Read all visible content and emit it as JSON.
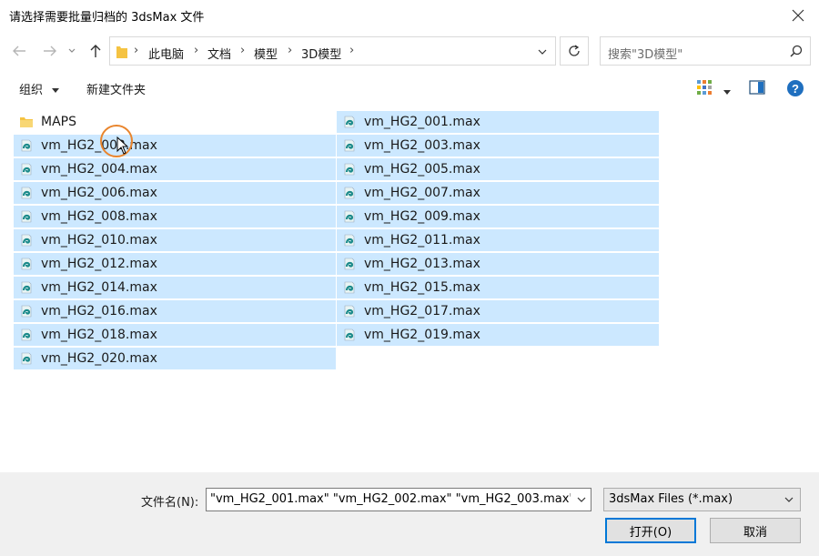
{
  "window": {
    "title": "请选择需要批量归档的 3dsMax 文件"
  },
  "address": {
    "crumbs": [
      "此电脑",
      "文档",
      "模型",
      "3D模型"
    ]
  },
  "search": {
    "placeholder": "搜索\"3D模型\""
  },
  "toolbar": {
    "organize": "组织",
    "new_folder": "新建文件夹"
  },
  "files": {
    "left": [
      {
        "name": "MAPS",
        "type": "folder",
        "selected": false
      },
      {
        "name": "vm_HG2_002.max",
        "type": "max",
        "selected": true
      },
      {
        "name": "vm_HG2_004.max",
        "type": "max",
        "selected": true
      },
      {
        "name": "vm_HG2_006.max",
        "type": "max",
        "selected": true
      },
      {
        "name": "vm_HG2_008.max",
        "type": "max",
        "selected": true
      },
      {
        "name": "vm_HG2_010.max",
        "type": "max",
        "selected": true
      },
      {
        "name": "vm_HG2_012.max",
        "type": "max",
        "selected": true
      },
      {
        "name": "vm_HG2_014.max",
        "type": "max",
        "selected": true
      },
      {
        "name": "vm_HG2_016.max",
        "type": "max",
        "selected": true
      },
      {
        "name": "vm_HG2_018.max",
        "type": "max",
        "selected": true
      },
      {
        "name": "vm_HG2_020.max",
        "type": "max",
        "selected": true
      }
    ],
    "right": [
      {
        "name": "vm_HG2_001.max",
        "type": "max",
        "selected": true
      },
      {
        "name": "vm_HG2_003.max",
        "type": "max",
        "selected": true
      },
      {
        "name": "vm_HG2_005.max",
        "type": "max",
        "selected": true
      },
      {
        "name": "vm_HG2_007.max",
        "type": "max",
        "selected": true
      },
      {
        "name": "vm_HG2_009.max",
        "type": "max",
        "selected": true
      },
      {
        "name": "vm_HG2_011.max",
        "type": "max",
        "selected": true
      },
      {
        "name": "vm_HG2_013.max",
        "type": "max",
        "selected": true
      },
      {
        "name": "vm_HG2_015.max",
        "type": "max",
        "selected": true
      },
      {
        "name": "vm_HG2_017.max",
        "type": "max",
        "selected": true
      },
      {
        "name": "vm_HG2_019.max",
        "type": "max",
        "selected": true
      }
    ]
  },
  "footer": {
    "filename_label": "文件名(N):",
    "filename_value": "\"vm_HG2_001.max\" \"vm_HG2_002.max\" \"vm_HG2_003.max\"",
    "filetype_value": "3dsMax Files (*.max)",
    "open_label": "打开(O)",
    "cancel_label": "取消"
  },
  "colors": {
    "selection": "#cce8ff",
    "accent": "#0078d7",
    "folder": "#f5c342",
    "max_icon": "#1b8a8a",
    "cursor_ring": "#e9852d"
  }
}
